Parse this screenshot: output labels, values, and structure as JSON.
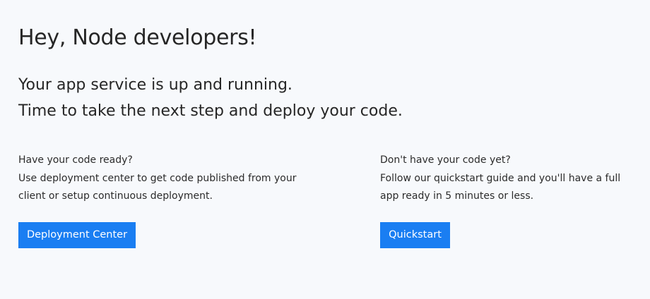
{
  "heading": "Hey, Node developers!",
  "subheading": {
    "line1": "Your app service is up and running.",
    "line2": "Time to take the next step and deploy your code."
  },
  "left_column": {
    "question": "Have your code ready?",
    "line1": "Use deployment center to get code published from your",
    "line2": "client or setup continuous deployment.",
    "button_label": "Deployment Center"
  },
  "right_column": {
    "question": "Don't have your code yet?",
    "line1": "Follow our quickstart guide and you'll have a full",
    "line2": "app ready in 5 minutes or less.",
    "button_label": "Quickstart"
  },
  "colors": {
    "background": "#f7f9fc",
    "accent": "#1a7ef2",
    "text": "#2b2b2b"
  }
}
